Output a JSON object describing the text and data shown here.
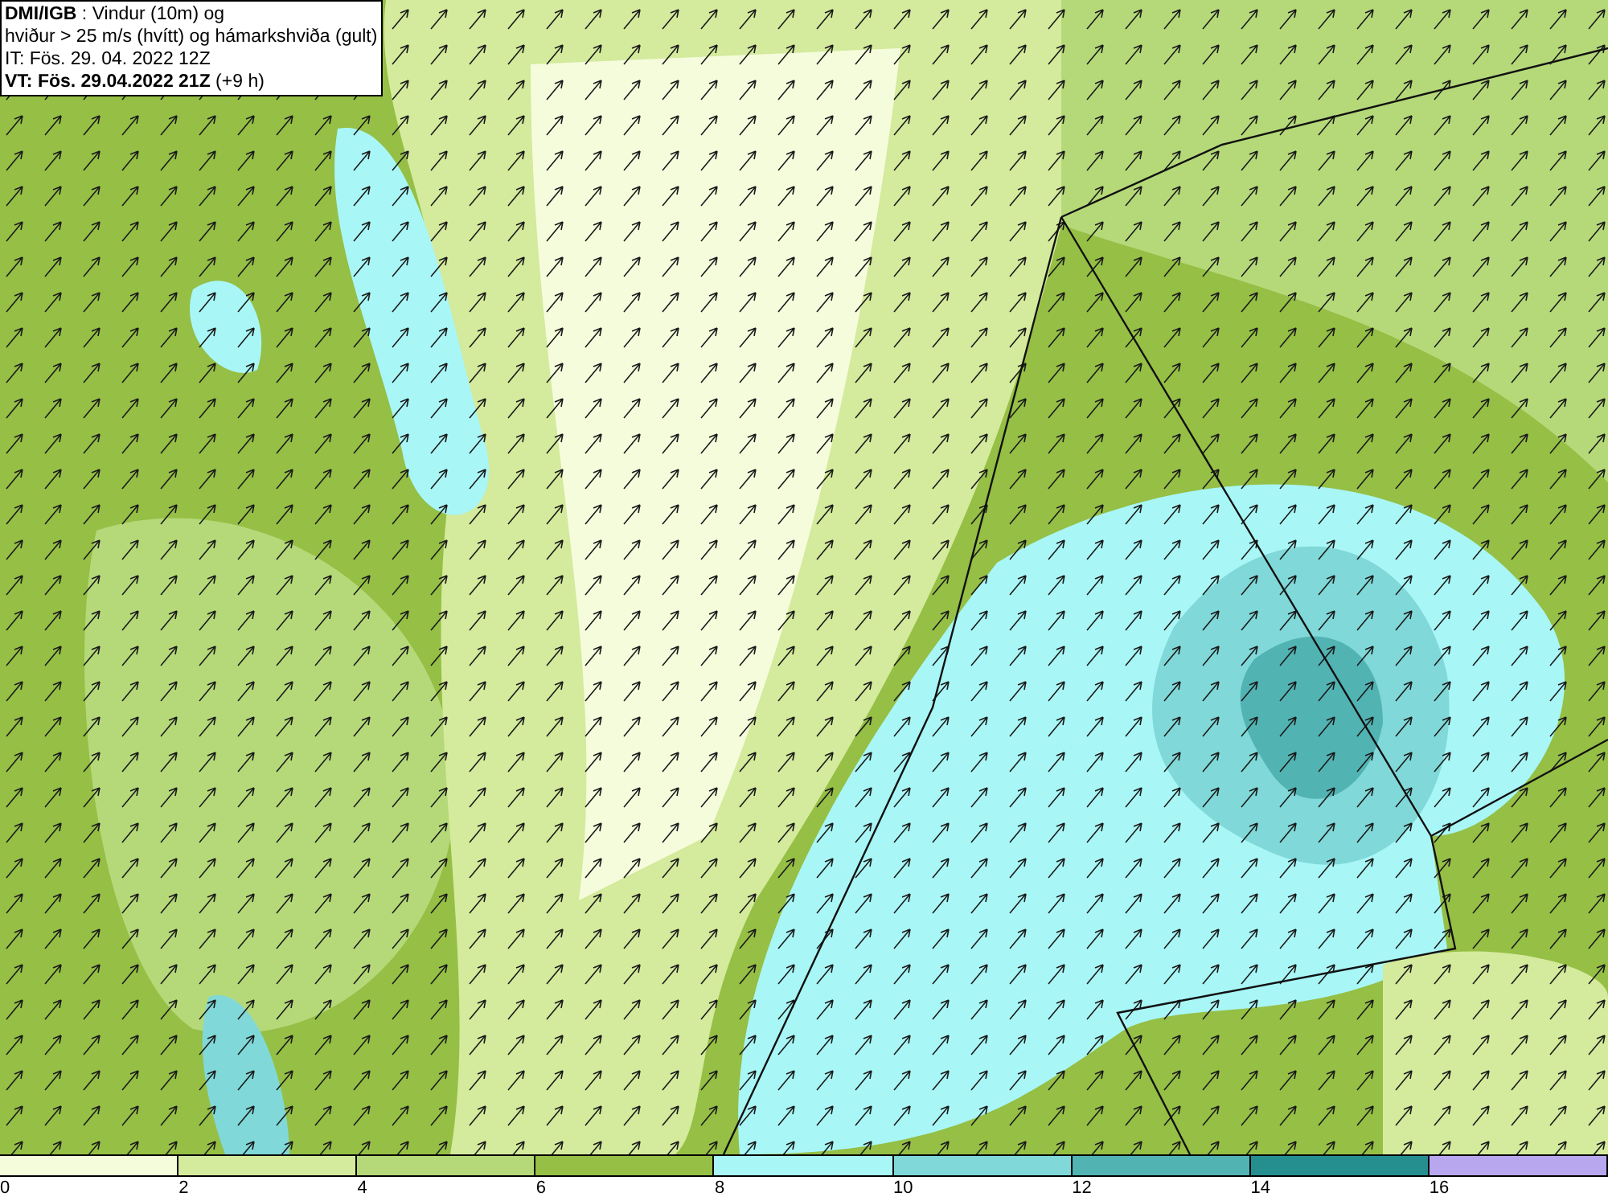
{
  "header": {
    "lines": [
      "**DMI/IGB** : Vindur (10m) og",
      "hviður > 25 m/s (hvítt) og hámarkshviða (gult)",
      "IT: Fös. 29. 04. 2022 12Z",
      "**VT: Fös. 29.04.2022 21Z** (+9 h)"
    ]
  },
  "legend": {
    "bins": [
      {
        "color": "#f5fcdc"
      },
      {
        "color": "#d4ea9c"
      },
      {
        "color": "#b5d979"
      },
      {
        "color": "#95bf45"
      },
      {
        "color": "#a9f6f6"
      },
      {
        "color": "#80d8d8"
      },
      {
        "color": "#52b3b3"
      },
      {
        "color": "#258f8f"
      },
      {
        "color": "#b8a7ef"
      }
    ],
    "ticks": [
      "0",
      "2",
      "4",
      "6",
      "8",
      "10",
      "12",
      "14",
      "16"
    ]
  }
}
